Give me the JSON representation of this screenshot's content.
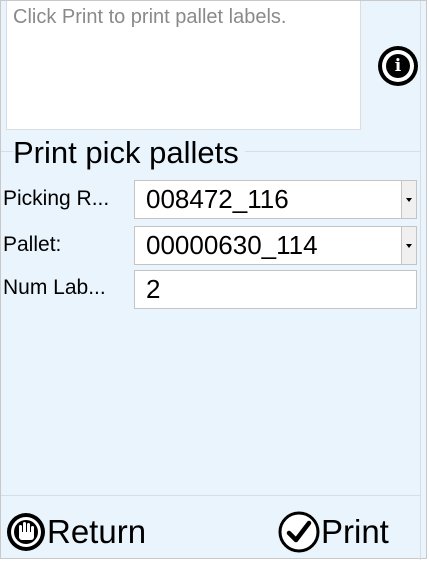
{
  "message": {
    "text": "Click Print to print pallet labels."
  },
  "info_button": {
    "icon": "info-icon",
    "glyph": "i"
  },
  "section": {
    "title": "Print pick pallets"
  },
  "fields": [
    {
      "label": "Picking R...",
      "value": "008472_116",
      "type": "dropdown"
    },
    {
      "label": "Pallet:",
      "value": "00000630_114",
      "type": "dropdown"
    },
    {
      "label": "Num Lab...",
      "value": "2",
      "type": "text"
    }
  ],
  "footer": {
    "return_label": "Return",
    "return_icon": "stop-hand-icon",
    "print_label": "Print",
    "print_icon": "checkmark-circle-icon"
  },
  "colors": {
    "background": "#eaf4fc",
    "field_background": "#ffffff",
    "message_text": "#8a8a8a"
  }
}
